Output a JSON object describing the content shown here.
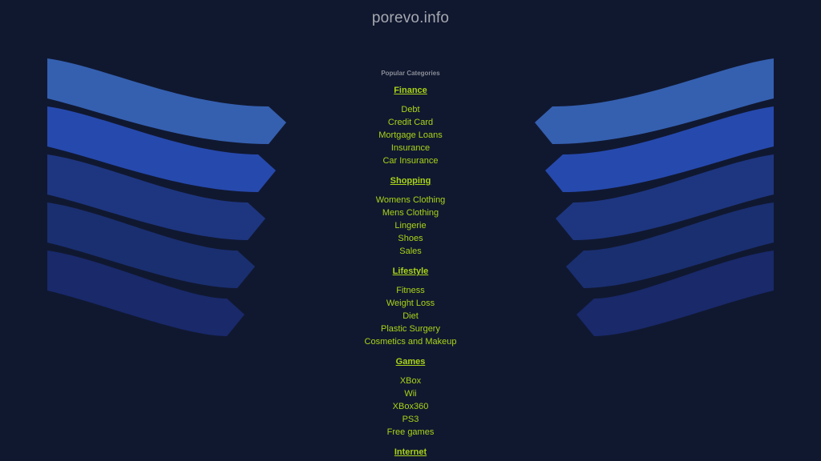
{
  "site": {
    "title": "porevo.info"
  },
  "popular_label": "Popular Categories",
  "groups": [
    {
      "heading": "Finance",
      "links": [
        "Debt",
        "Credit Card",
        "Mortgage Loans",
        "Insurance",
        "Car Insurance"
      ]
    },
    {
      "heading": "Shopping",
      "links": [
        "Womens Clothing",
        "Mens Clothing",
        "Lingerie",
        "Shoes",
        "Sales"
      ]
    },
    {
      "heading": "Lifestyle",
      "links": [
        "Fitness",
        "Weight Loss",
        "Diet",
        "Plastic Surgery",
        "Cosmetics and Makeup"
      ]
    },
    {
      "heading": "Games",
      "links": [
        "XBox",
        "Wii",
        "XBox360",
        "PS3",
        "Free games"
      ]
    },
    {
      "heading": "Internet",
      "links": []
    }
  ],
  "colors": {
    "background": "#101830",
    "link": "#a9d317",
    "title": "#a7a9b0",
    "ribbons": [
      "#3560b0",
      "#2649ad",
      "#1e3680",
      "#1a2f70",
      "#19296a"
    ]
  }
}
